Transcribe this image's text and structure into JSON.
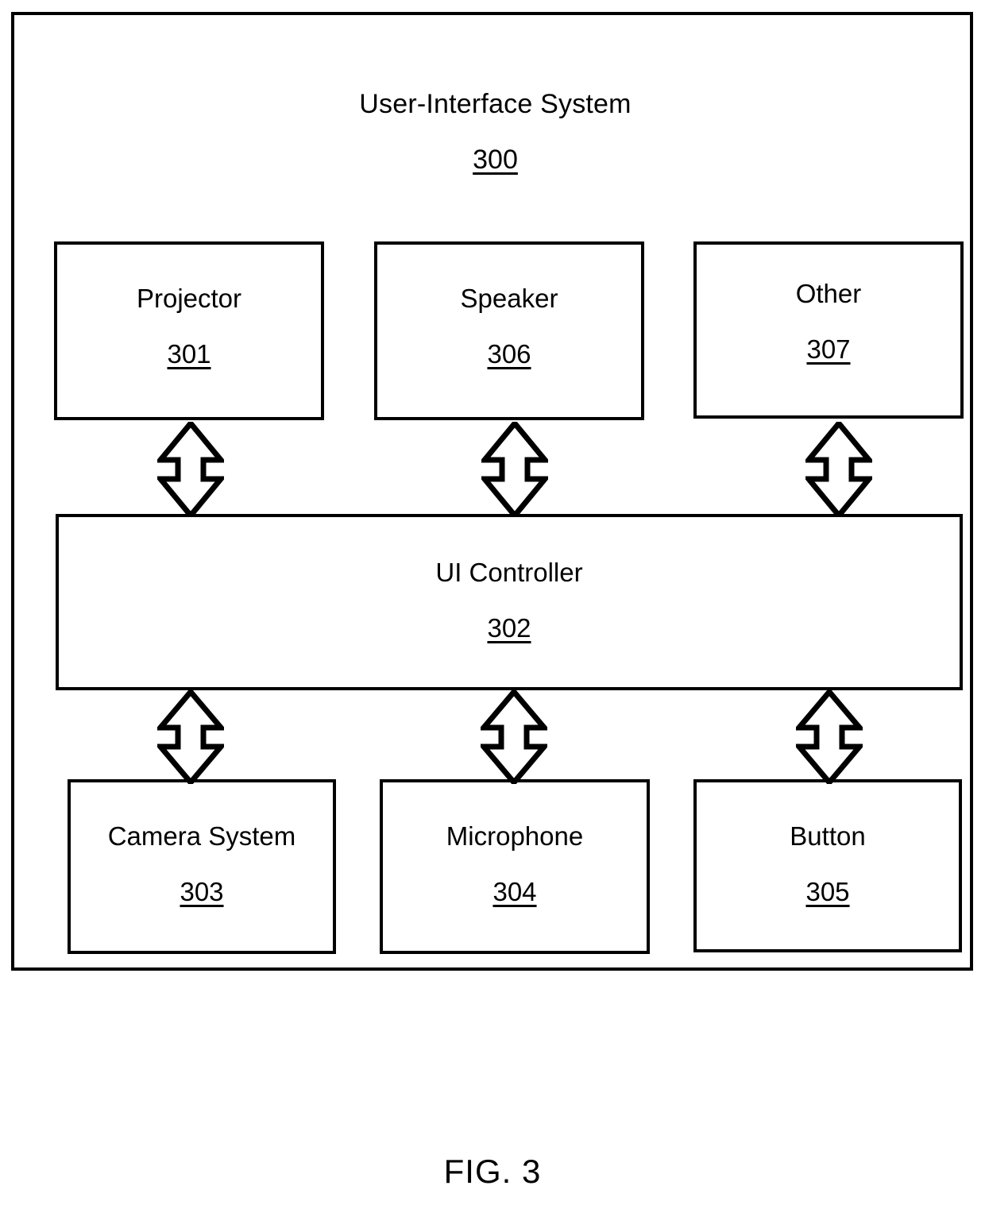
{
  "figure": {
    "caption": "FIG. 3"
  },
  "system": {
    "title": "User-Interface System",
    "ref": "300"
  },
  "boxes": [
    {
      "id": "projector",
      "label": "Projector",
      "ref": "301"
    },
    {
      "id": "speaker",
      "label": "Speaker",
      "ref": "306"
    },
    {
      "id": "other",
      "label": "Other",
      "ref": "307"
    },
    {
      "id": "ui-controller",
      "label": "UI Controller",
      "ref": "302"
    },
    {
      "id": "camera-system",
      "label": "Camera System",
      "ref": "303"
    },
    {
      "id": "microphone",
      "label": "Microphone",
      "ref": "304"
    },
    {
      "id": "button",
      "label": "Button",
      "ref": "305"
    }
  ],
  "connectors": [
    {
      "id": "projector-ui",
      "from": "301",
      "to": "302",
      "style": "double-headed-arrow"
    },
    {
      "id": "speaker-ui",
      "from": "306",
      "to": "302",
      "style": "double-headed-arrow"
    },
    {
      "id": "other-ui",
      "from": "307",
      "to": "302",
      "style": "double-headed-arrow"
    },
    {
      "id": "ui-camera",
      "from": "302",
      "to": "303",
      "style": "double-headed-arrow"
    },
    {
      "id": "ui-microphone",
      "from": "302",
      "to": "304",
      "style": "double-headed-arrow"
    },
    {
      "id": "ui-button",
      "from": "302",
      "to": "305",
      "style": "double-headed-arrow"
    }
  ],
  "colors": {
    "stroke": "#000000",
    "background": "#ffffff"
  }
}
